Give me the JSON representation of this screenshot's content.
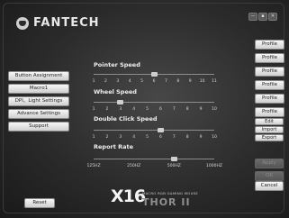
{
  "app": {
    "logo_text": "FANTECH",
    "model": "X16",
    "model_tagline": "MACRO RGB GAMING MOUSE",
    "model_name": "THOR II"
  },
  "window_controls": {
    "minimize": "—",
    "restore": "▪",
    "close": "✕"
  },
  "sidebar": {
    "items": [
      {
        "label": "Button Assignment"
      },
      {
        "label": "Macro1"
      },
      {
        "label": "DPI、Light Settings"
      },
      {
        "label": "Advance Settings"
      },
      {
        "label": "Support"
      }
    ],
    "reset_label": "Reset"
  },
  "profiles": [
    "Profile",
    "Profile",
    "Profile",
    "Profile",
    "Profile",
    "Profile"
  ],
  "profile_actions": {
    "edit": "Edit",
    "import": "Import",
    "export": "Export"
  },
  "dialog_buttons": {
    "apply": "Apply",
    "ok": "OK",
    "cancel": "Cancel"
  },
  "settings": {
    "pointer_speed": {
      "title": "Pointer Speed",
      "ticks": [
        "1",
        "2",
        "3",
        "4",
        "5",
        "6",
        "7",
        "8",
        "9",
        "10",
        "11"
      ],
      "value": 6
    },
    "wheel_speed": {
      "title": "Wheel Speed",
      "ticks": [
        "1",
        "2",
        "3",
        "4",
        "5",
        "6",
        "7",
        "8",
        "9",
        "10"
      ],
      "value": 3
    },
    "double_click_speed": {
      "title": "Double Click Speed",
      "ticks": [
        "1",
        "2",
        "3",
        "4",
        "5",
        "6",
        "7",
        "8",
        "9",
        "10"
      ],
      "value": 6
    },
    "report_rate": {
      "title": "Report Rate",
      "ticks": [
        "125HZ",
        "250HZ",
        "500HZ",
        "1000HZ"
      ],
      "value": "500HZ"
    }
  }
}
